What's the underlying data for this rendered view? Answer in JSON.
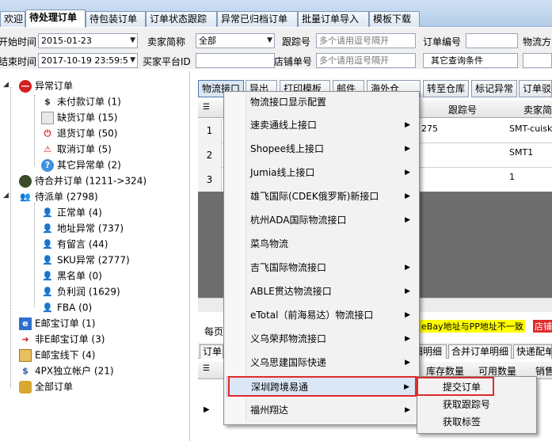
{
  "top_tabs": [
    "欢迎",
    "待处理订单",
    "待包装订单",
    "订单状态跟踪",
    "异常已归档订单",
    "批量订单导入",
    "模板下载"
  ],
  "active_tab_index": 1,
  "filters": {
    "start_time_label": "开始时间",
    "start_time_value": "2015-01-23",
    "end_time_label": "结束时间",
    "end_time_value": "2017-10-19 23:59:5",
    "seller_short_label": "卖家简称",
    "seller_short_value": "全部",
    "seller_platform_id_label": "买家平台ID",
    "tracking_no_label": "跟踪号",
    "tracking_no_placeholder": "多个请用逗号隔开",
    "order_no_label": "订单编号",
    "logistics_label": "物流方",
    "shop_order_label": "店铺单号",
    "shop_order_placeholder": "多个请用逗号隔开",
    "other_query_label": "其它查询条件"
  },
  "tree": {
    "abnormal": "异常订单",
    "unpaid": "未付款订单 (1)",
    "out_of_stock": "缺货订单 (15)",
    "refund": "退货订单 (50)",
    "cancel": "取消订单 (5)",
    "other_abnormal": "其它异常单 (2)",
    "pending_merge": "待合并订单 (1211->324)",
    "pending_review": "待派单 (2798)",
    "normal": "正常单 (4)",
    "addr_abnormal": "地址异常 (737)",
    "has_message": "有留言 (44)",
    "sku_abnormal": "SKU异常 (2777)",
    "blacklist": "黑名单 (0)",
    "negative_profit": "负利润 (1629)",
    "fba": "FBA (0)",
    "ebay_orders": "E邮宝订单 (1)",
    "non_ebay": "非E邮宝订单 (3)",
    "ebay_offline": "E邮宝线下 (4)",
    "fourpx": "4PX独立帐户 (21)",
    "all_orders": "全部订单"
  },
  "toolbar": {
    "logistics_interface": "物流接口",
    "export": "导出",
    "print_template": "打印模板",
    "mail": "邮件",
    "overseas_warehouse": "海外仓",
    "transfer_warehouse": "转至仓库",
    "mark_abnormal": "标记异常",
    "order_reject": "订单驳"
  },
  "grid": {
    "headers": {
      "tracking_no": "跟踪号",
      "seller": "卖家简"
    },
    "rows": [
      {
        "num": "1",
        "tracking": "275",
        "seller": "SMT-cuisk"
      },
      {
        "num": "2",
        "tracking": "",
        "seller": "SMT1"
      },
      {
        "num": "3",
        "tracking": "",
        "seller": "1"
      }
    ]
  },
  "status": {
    "per_page": "每页",
    "ebay_warning": "eBay地址与PP地址不一致",
    "store_tag": "店铺"
  },
  "sub_tabs": [
    "订单",
    "细明细",
    "合并订单明细",
    "快递配单"
  ],
  "sub_grid_headers": [
    "库存数量",
    "可用数量",
    "销售"
  ],
  "menu": {
    "items": [
      "物流接口显示配置",
      "速卖通线上接口",
      "Shopee线上接口",
      "Jumia线上接口",
      "雄飞国际(CDEK俄罗斯)新接口",
      "杭州ADA国际物流接口",
      "菜鸟物流",
      "吉飞国际物流接口",
      "ABLE贯达物流接口",
      "eTotal（前海易达）物流接口",
      "义乌荣邦物流接口",
      "义乌思建国际快递",
      "深圳跨境易通",
      "福州翔达"
    ],
    "has_submenu": [
      false,
      true,
      true,
      true,
      true,
      true,
      false,
      true,
      true,
      true,
      true,
      true,
      true,
      true
    ],
    "selected_index": 12
  },
  "submenu": {
    "items": [
      "提交订单",
      "获取跟踪号",
      "获取标签"
    ]
  },
  "colors": {
    "highlight_red": "#e02a2a",
    "menu_selected": "#dbe7f6",
    "tab_blue": "#b4cde8"
  }
}
